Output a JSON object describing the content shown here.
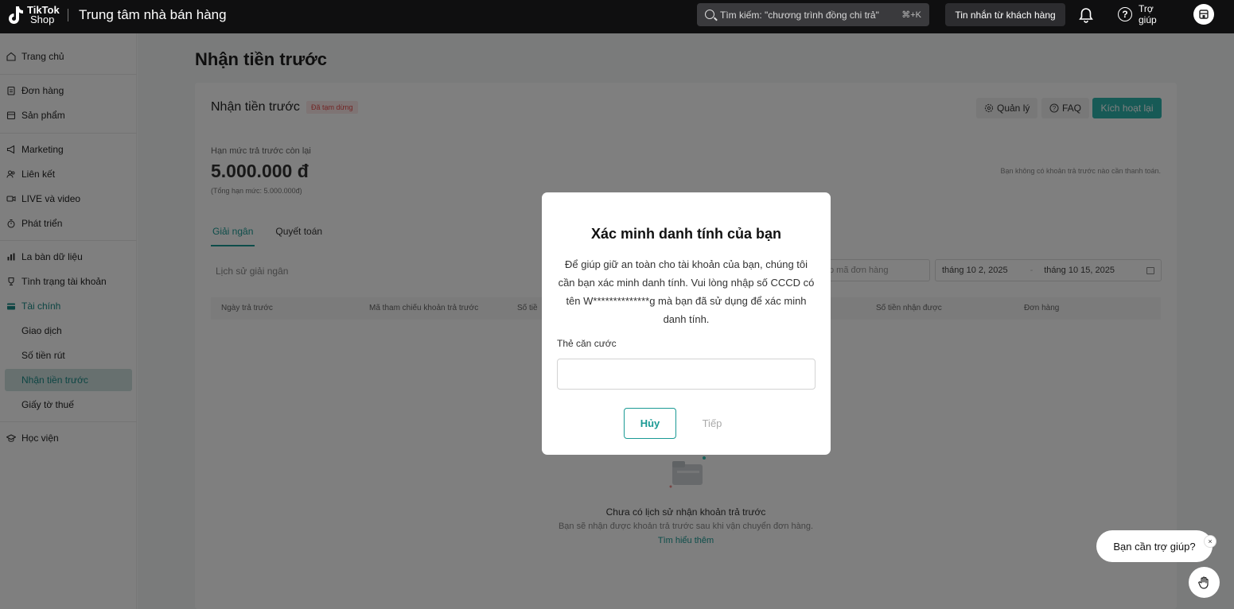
{
  "topbar": {
    "logo_line1": "TikTok",
    "logo_line2": "Shop",
    "app_title": "Trung tâm nhà bán hàng",
    "search_placeholder": "Tìm kiếm: \"chương trình đồng chi trả\"",
    "search_shortcut": "⌘+K",
    "messages_label": "Tin nhắn từ khách hàng",
    "help_label": "Trợ giúp"
  },
  "sidebar": {
    "home": "Trang chủ",
    "orders": "Đơn hàng",
    "products": "Sản phẩm",
    "marketing": "Marketing",
    "affiliate": "Liên kết",
    "live_video": "LIVE và video",
    "growth": "Phát triển",
    "data_compass": "La bàn dữ liệu",
    "account_health": "Tình trạng tài khoản",
    "finance": "Tài chính",
    "transactions": "Giao dịch",
    "withdrawals": "Số tiền rút",
    "advance_payment": "Nhận tiền trước",
    "tax_documents": "Giấy tờ thuế",
    "academy": "Học viện"
  },
  "main": {
    "page_title": "Nhận tiền trước",
    "card_title": "Nhận tiền trước",
    "status_badge": "Đã tạm dừng",
    "manage_label": "Quản lý",
    "faq_label": "FAQ",
    "reactivate_label": "Kích hoạt lại",
    "limit_label": "Hạn mức trả trước còn lại",
    "limit_value": "5.000.000 đ",
    "limit_total": "(Tổng hạn mức: 5.000.000đ)",
    "no_due_text": "Bạn không có khoản trả trước nào cần thanh toán.",
    "tabs": [
      "Giải ngân",
      "Quyết toán"
    ],
    "history_label": "Lịch sử giải ngân",
    "order_search_placeholder": "p mã đơn hàng",
    "date_start": "tháng 10 2, 2025",
    "date_end": "tháng 10 15, 2025",
    "columns": [
      "Ngày trả trước",
      "Mã tham chiếu khoản trả trước",
      "Số tiề",
      "Số tiền nhận được",
      "Đơn hàng"
    ],
    "empty_title": "Chưa có lịch sử nhận khoản trả trước",
    "empty_subtitle": "Bạn sẽ nhận được khoản trả trước sau khi vận chuyển đơn hàng.",
    "learn_more": "Tìm hiểu thêm"
  },
  "modal": {
    "title": "Xác minh danh tính của bạn",
    "body": "Để giúp giữ an toàn cho tài khoản của bạn, chúng tôi cần bạn xác minh danh tính. Vui lòng nhập số CCCD có tên W**************g mà bạn đã sử dụng để xác minh danh tính.",
    "field_label": "Thẻ căn cước",
    "field_value": "",
    "cancel_label": "Hủy",
    "next_label": "Tiếp"
  },
  "help_widget": {
    "bubble_text": "Bạn cần trợ giúp?",
    "close_label": "×"
  }
}
